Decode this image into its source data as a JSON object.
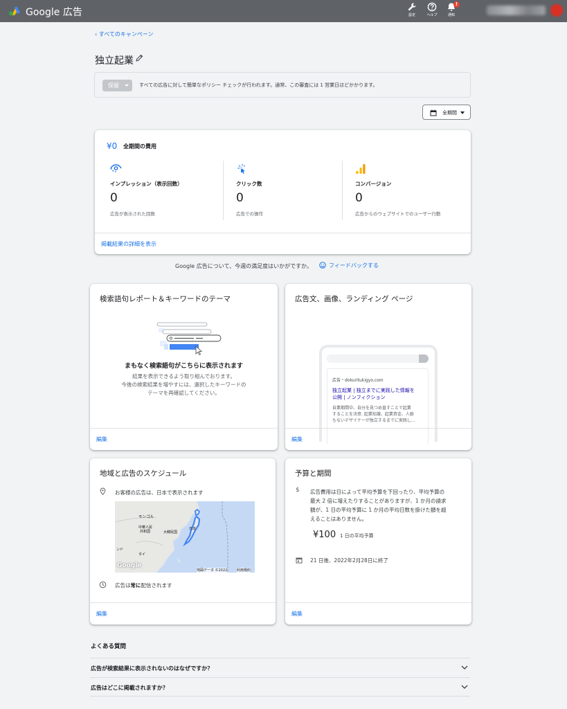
{
  "topbar": {
    "brand": "Google 広告",
    "tools_label": "設定",
    "help_label": "ヘルプ",
    "notifications_label": "通知",
    "notification_badge": "!"
  },
  "nav": {
    "back_label": "すべてのキャンペーン"
  },
  "campaign": {
    "title": "独立起業"
  },
  "policy": {
    "status": "保留",
    "message": "すべての広告に対して簡単なポリシー チェックが行われます。通常、この審査には 1 営業日ほどかかります。"
  },
  "date_range": {
    "label": "全期間"
  },
  "summary": {
    "cost_value": "¥0",
    "cost_label": "全期間の費用",
    "metrics": [
      {
        "name": "インプレッション（表示回数）",
        "value": "0",
        "description": "広告が表示された回数",
        "icon": "eye-icon"
      },
      {
        "name": "クリック数",
        "value": "0",
        "description": "広告での操作",
        "icon": "click-icon"
      },
      {
        "name": "コンバージョン",
        "value": "0",
        "description": "広告からのウェブサイトでのユーザー行動",
        "icon": "bar-chart-icon"
      }
    ],
    "details_link": "掲載結果の詳細を表示"
  },
  "feedback": {
    "question": "Google 広告について、今週の満足度はいかがですか。",
    "link": "フィードバックする"
  },
  "keywords_card": {
    "title": "検索語句レポート＆キーワードのテーマ",
    "heading": "まもなく検索語句がこちらに表示されます",
    "body_lines": [
      "結果を表示できるよう取り組んでおります。",
      "今後の検索結果を増やすには、選択したキーワードの",
      "テーマを再確認してください。"
    ],
    "edit_label": "編集"
  },
  "ads_card": {
    "title": "広告文、画像、ランディング ページ",
    "ad_display": "広告・dokuritukigyo.com",
    "ad_headline_lines": [
      "独立起業 | 独立までに実践した情報を",
      "公開 | ノンフィクション"
    ],
    "ad_description_lines": [
      "自業期間中、自分を見つめ直すことで起業",
      "することを決意. 起業知識、起業資金、人脈",
      "もないデザイナーが独立するまでに実践し..."
    ],
    "edit_label": "編集"
  },
  "geo_card": {
    "title": "地域と広告のスケジュール",
    "location_text": "お客様の広告は、日本で表示されます",
    "map": {
      "labels": [
        "モンゴル",
        "中華人民",
        "共和国",
        "大韓民国",
        "日本",
        "タイ",
        "ンド"
      ],
      "logo": "Google",
      "attribution": "地図データ ©2022",
      "terms": "利用規約"
    },
    "schedule_prefix": "広告は",
    "schedule_emphasis": "常に",
    "schedule_suffix": "配信されます",
    "edit_label": "編集"
  },
  "budget_card": {
    "title": "予算と期間",
    "description_lines": [
      "広告費用は日によって平均予算を下回ったり、平均予算の",
      "最大 2 倍に増えたりすることがありますが、1 か月の請求",
      "額が、1 日の平均予算に 1 か月の平均日数を掛けた額を超",
      "えることはありません。"
    ],
    "daily_budget": "¥100",
    "daily_budget_label": "1 日の平均予算",
    "end_text": "21 日後、2022年2月28日に終了",
    "edit_label": "編集"
  },
  "faq": {
    "title": "よくある質問",
    "items": [
      {
        "question": "広告が検索結果に表示されないのはなぜですか？"
      },
      {
        "question": "広告はどこに掲載されますか？"
      }
    ]
  },
  "colors": {
    "topbar": "#5f6368",
    "link": "#1a73e8",
    "background": "#f1f3f4",
    "ad_headline": "#1a0dab"
  }
}
